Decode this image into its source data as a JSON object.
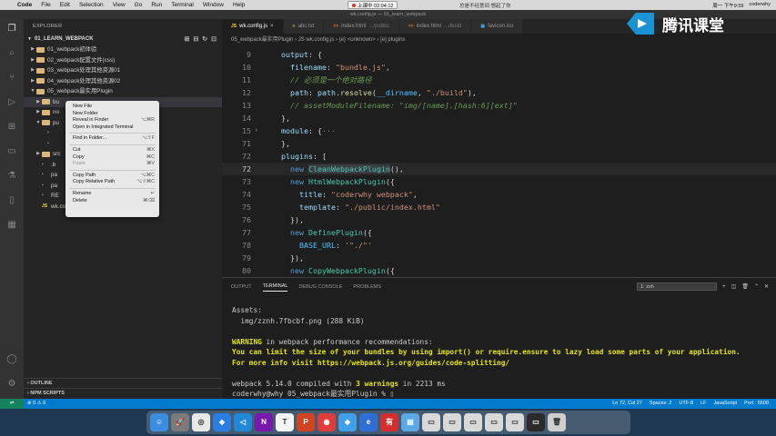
{
  "menubar": {
    "app": "Code",
    "items": [
      "File",
      "Edit",
      "Selection",
      "View",
      "Go",
      "Run",
      "Terminal",
      "Window",
      "Help"
    ],
    "recording": "上课中 02:04:12",
    "center_text": "总是不经意间 想起了你",
    "clock": "周一 下午9:59",
    "user": "coderwhy"
  },
  "window_title": "wk.config.js — 01_learn_webpack",
  "sidebar": {
    "header": "EXPLORER",
    "project": "01_LEARN_WEBPACK",
    "tree": [
      {
        "label": "01_webpack初体验",
        "type": "folder",
        "indent": 1
      },
      {
        "label": "02_webpack配置文件(css)",
        "type": "folder",
        "indent": 1
      },
      {
        "label": "03_webpack处理其他资源01",
        "type": "folder",
        "indent": 1
      },
      {
        "label": "04_webpack处理其他资源02",
        "type": "folder",
        "indent": 1
      },
      {
        "label": "05_webpack最实用Plugin",
        "type": "folder-open",
        "indent": 1
      },
      {
        "label": "bu",
        "type": "folder",
        "indent": 2
      },
      {
        "label": "no",
        "type": "folder",
        "indent": 2
      },
      {
        "label": "pu",
        "type": "folder-open",
        "indent": 2
      },
      {
        "label": "",
        "type": "file",
        "indent": 3
      },
      {
        "label": "",
        "type": "file",
        "indent": 3
      },
      {
        "label": "src",
        "type": "folder",
        "indent": 2
      },
      {
        "label": ".b",
        "type": "file",
        "indent": 2
      },
      {
        "label": "pa",
        "type": "file",
        "indent": 2
      },
      {
        "label": "pa",
        "type": "file",
        "indent": 2
      },
      {
        "label": "RE",
        "type": "file",
        "indent": 2
      },
      {
        "label": "wk.config.js",
        "type": "js",
        "indent": 2
      }
    ],
    "outline": "OUTLINE",
    "npm_scripts": "NPM SCRIPTS"
  },
  "context_menu": {
    "groups": [
      [
        {
          "label": "New File",
          "key": ""
        },
        {
          "label": "New Folder",
          "key": ""
        },
        {
          "label": "Reveal in Finder",
          "key": "⌥⌘R"
        },
        {
          "label": "Open in Integrated Terminal",
          "key": ""
        }
      ],
      [
        {
          "label": "Find in Folder...",
          "key": "⌥⇧F"
        }
      ],
      [
        {
          "label": "Cut",
          "key": "⌘X"
        },
        {
          "label": "Copy",
          "key": "⌘C"
        },
        {
          "label": "Paste",
          "key": "⌘V",
          "disabled": true
        }
      ],
      [
        {
          "label": "Copy Path",
          "key": "⌥⌘C"
        },
        {
          "label": "Copy Relative Path",
          "key": "⌥⇧⌘C"
        }
      ],
      [
        {
          "label": "Rename",
          "key": "↵"
        },
        {
          "label": "Delete",
          "key": "⌘⌫"
        }
      ]
    ]
  },
  "tabs": [
    {
      "label": "wk.config.js",
      "sub": "",
      "icon": "JS",
      "active": true
    },
    {
      "label": "abc.txt",
      "sub": "",
      "icon": "≡",
      "active": false
    },
    {
      "label": "index.html",
      "sub": ".../public",
      "icon": "<>",
      "active": false
    },
    {
      "label": "index.html",
      "sub": ".../build",
      "icon": "<>",
      "active": false
    },
    {
      "label": "favicon.ico",
      "sub": "",
      "icon": "▣",
      "active": false
    }
  ],
  "breadcrumb": "05_webpack最实用Plugin › JS wk.config.js › {e} <unknown> › [e] plugins",
  "editor": {
    "current_line": "72",
    "lines": [
      {
        "n": "9",
        "html": "  <span class='p'>output</span>: {"
      },
      {
        "n": "10",
        "html": "    <span class='p'>filename</span>: <span class='s'>\"bundle.js\"</span>,"
      },
      {
        "n": "11",
        "html": "    <span class='c'>// 必须是一个绝对路径</span>"
      },
      {
        "n": "12",
        "html": "    <span class='p'>path</span>: <span class='p'>path</span>.<span class='f'>resolve</span>(<span class='cst'>__dirname</span>, <span class='s'>\"./build\"</span>),"
      },
      {
        "n": "13",
        "html": "    <span class='c'>// assetModuleFilename: \"img/[name].[hash:6][ext]\"</span>"
      },
      {
        "n": "14",
        "html": "  },"
      },
      {
        "n": "15",
        "html": "  <span class='p'>module</span>: {<span style='color:#888'>···</span>",
        "fold": true
      },
      {
        "n": "71",
        "html": "  },"
      },
      {
        "n": "72",
        "html": "  <span class='p'>plugins</span>: ["
      },
      {
        "n": "72",
        "html": "    <span class='k'>new</span> <span class='cl hl'>CleanWebpackPlugin</span>(),"
      },
      {
        "n": "73",
        "html": "    <span class='k'>new</span> <span class='cl'>HtmlWebpackPlugin</span>({"
      },
      {
        "n": "74",
        "html": "      <span class='p'>title</span>: <span class='s'>\"coderwhy webpack\"</span>,"
      },
      {
        "n": "75",
        "html": "      <span class='p'>template</span>: <span class='s'>\"./public/index.html\"</span>"
      },
      {
        "n": "76",
        "html": "    }),"
      },
      {
        "n": "77",
        "html": "    <span class='k'>new</span> <span class='cl'>DefinePlugin</span>({"
      },
      {
        "n": "78",
        "html": "      <span class='cst'>BASE_URL</span>: <span class='s'>'\"./\"'</span>"
      },
      {
        "n": "79",
        "html": "    }),"
      },
      {
        "n": "80",
        "html": "    <span class='k'>new</span> <span class='cl'>CopyWebpackPlugin</span>({"
      }
    ]
  },
  "panel": {
    "tabs": [
      "OUTPUT",
      "TERMINAL",
      "DEBUG CONSOLE",
      "PROBLEMS"
    ],
    "active_tab": "TERMINAL",
    "terminal_select": "1: zsh",
    "terminal_lines": [
      {
        "html": "Assets:"
      },
      {
        "html": "  img/zznh.7fbcbf.png (288 KiB)"
      },
      {
        "html": ""
      },
      {
        "html": "<span class='y'>WARNING</span> in webpack performance recommendations:"
      },
      {
        "html": "<span class='y'>You can limit the size of your bundles by using import() or require.ensure to lazy load some parts of your application.</span>"
      },
      {
        "html": "<span class='y'>For more info visit https://webpack.js.org/guides/code-splitting/</span>"
      },
      {
        "html": ""
      },
      {
        "html": "webpack 5.14.0 compiled with <span class='y'>3 warnings</span> in 2213 ms"
      },
      {
        "html": "coderwhy@why 05_webpack最实用Plugin % ▯"
      }
    ]
  },
  "status": {
    "left": "⊗ 0  ⚠ 0",
    "position": "Ln 72, Col 27",
    "spaces": "Spaces: 2",
    "encoding": "UTF-8",
    "eol": "LF",
    "language": "JavaScript",
    "port": "Port : 5500"
  },
  "watermark": "腾讯课堂",
  "dock_apps": [
    {
      "name": "finder",
      "color": "#3b8de0",
      "glyph": "☺"
    },
    {
      "name": "launchpad",
      "color": "#7a7a7a",
      "glyph": "🚀"
    },
    {
      "name": "chrome",
      "color": "#e8e8e8",
      "glyph": "◎"
    },
    {
      "name": "safari",
      "color": "#2a7de1",
      "glyph": "◈"
    },
    {
      "name": "vscode",
      "color": "#1f88d9",
      "glyph": "◁"
    },
    {
      "name": "onenote",
      "color": "#7719aa",
      "glyph": "N"
    },
    {
      "name": "typora",
      "color": "#f4f4f4",
      "glyph": "T"
    },
    {
      "name": "powerpoint",
      "color": "#d04423",
      "glyph": "P"
    },
    {
      "name": "netease-music",
      "color": "#e13c3c",
      "glyph": "◉"
    },
    {
      "name": "app-blue",
      "color": "#3fa0e8",
      "glyph": "◆"
    },
    {
      "name": "app-ie",
      "color": "#2e6fd6",
      "glyph": "e"
    },
    {
      "name": "app-red",
      "color": "#d42e2e",
      "glyph": "有"
    },
    {
      "name": "folder",
      "color": "#5aa9e6",
      "glyph": "▤"
    },
    {
      "name": "window-1",
      "color": "#d9d9d9",
      "glyph": "▭"
    },
    {
      "name": "window-2",
      "color": "#d9d9d9",
      "glyph": "▭"
    },
    {
      "name": "window-3",
      "color": "#d9d9d9",
      "glyph": "▭"
    },
    {
      "name": "window-4",
      "color": "#d9d9d9",
      "glyph": "▭"
    },
    {
      "name": "window-5",
      "color": "#d9d9d9",
      "glyph": "▭"
    },
    {
      "name": "terminal",
      "color": "#2b2b2b",
      "glyph": "▭"
    },
    {
      "name": "trash",
      "color": "#cfcfcf",
      "glyph": "🗑"
    }
  ]
}
